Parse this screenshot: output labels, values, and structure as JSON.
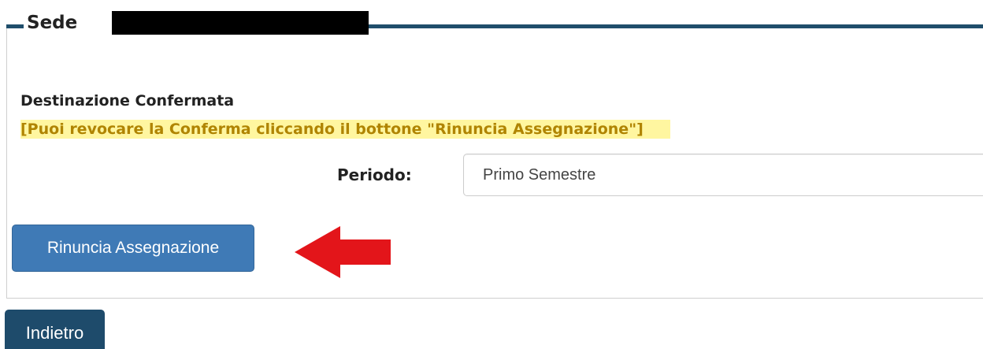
{
  "section": {
    "legend_title": "Sede",
    "status_title": "Destinazione Confermata",
    "note": "[Puoi revocare la Conferma cliccando il bottone \"Rinuncia Assegnazione\"]"
  },
  "form": {
    "periodo_label": "Periodo:",
    "periodo_value": "Primo Semestre"
  },
  "buttons": {
    "rinuncia_label": "Rinuncia Assegnazione",
    "indietro_label": "Indietro"
  },
  "colors": {
    "legend_line": "#1f4e6b",
    "primary_button": "#3f7ab6",
    "back_button": "#1e4b6b",
    "highlight_bg": "#fff6a0",
    "highlight_text": "#b08400",
    "arrow": "#e3151a"
  },
  "icons": {
    "annotation_arrow": "left-arrow-icon"
  }
}
